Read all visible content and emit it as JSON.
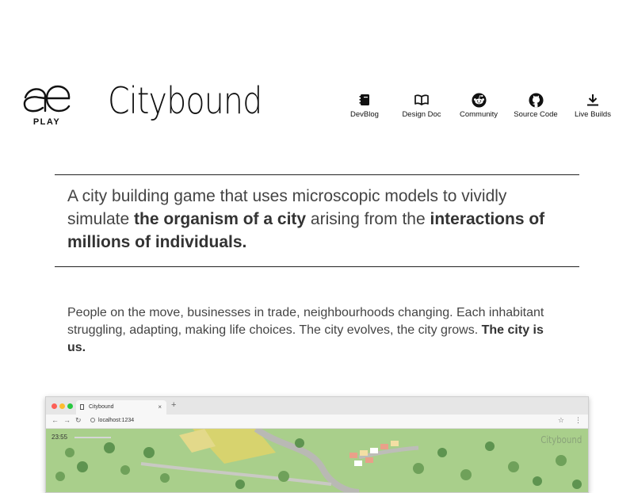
{
  "logo": {
    "icon": "ae-logo-icon",
    "sub_label": "PLAY"
  },
  "brand": {
    "name": "Citybound"
  },
  "nav": [
    {
      "label": "DevBlog",
      "icon": "notebook-icon"
    },
    {
      "label": "Design Doc",
      "icon": "open-book-icon"
    },
    {
      "label": "Community",
      "icon": "reddit-icon"
    },
    {
      "label": "Source Code",
      "icon": "github-icon"
    },
    {
      "label": "Live Builds",
      "icon": "download-icon"
    }
  ],
  "tagline": {
    "part1": "A city building game that uses microscopic models to vividly simulate ",
    "bold1": "the organism of a city",
    "part2": " arising from the ",
    "bold2": "interactions of millions of individuals."
  },
  "description": {
    "text": "People on the move, businesses in trade, neighbourhoods changing. Each inhabitant struggling, adapting, making life choices. The city evolves, the city grows. ",
    "bold": "The city is us."
  },
  "screenshot": {
    "tab_title": "Citybound",
    "tab_close": "×",
    "new_tab": "+",
    "back": "←",
    "forward": "→",
    "reload": "↻",
    "url": "localhost:1234",
    "star": "☆",
    "menu": "⋮",
    "game_time": "23:55",
    "game_brand": "Citybound",
    "traffic_colors": [
      "#fc5f57",
      "#fdbc2e",
      "#28c840"
    ]
  },
  "colors": {
    "text": "#444444",
    "rule": "#222222",
    "grass": "#a9cf8b"
  }
}
